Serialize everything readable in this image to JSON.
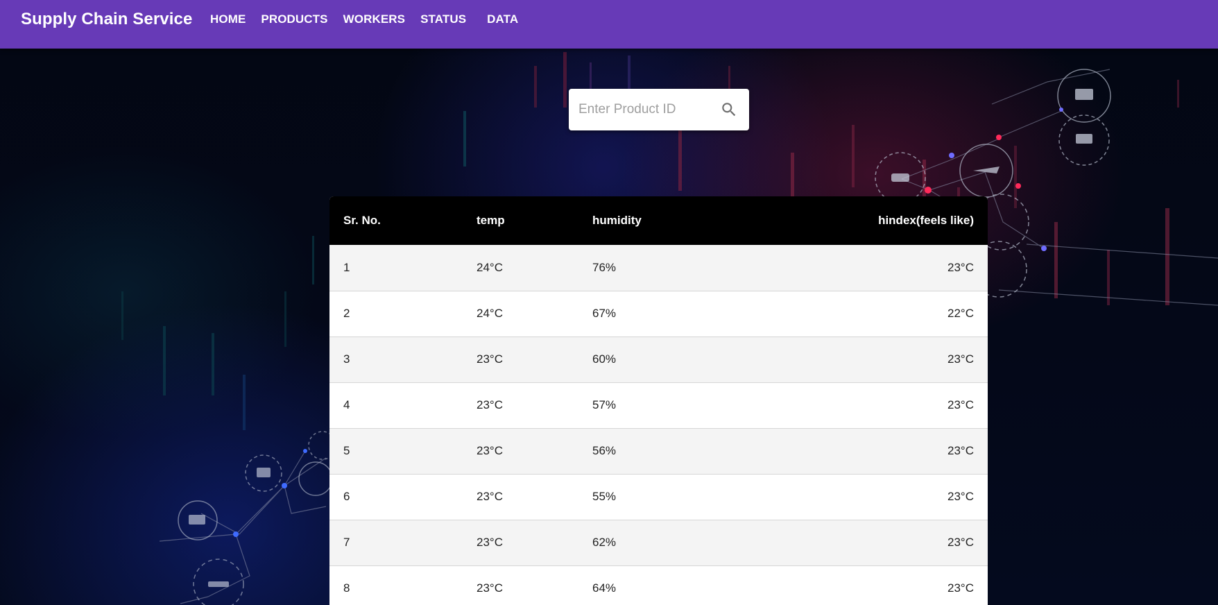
{
  "app": {
    "title": "Supply Chain Service"
  },
  "nav": {
    "items": [
      "HOME",
      "PRODUCTS",
      "WORKERS",
      "STATUS",
      "DATA"
    ]
  },
  "search": {
    "placeholder": "Enter Product ID",
    "value": "",
    "icon": "search-icon"
  },
  "table": {
    "headers": [
      "Sr. No.",
      "temp",
      "humidity",
      "hindex(feels like)"
    ],
    "rows": [
      [
        "1",
        "24°C",
        "76%",
        "23°C"
      ],
      [
        "2",
        "24°C",
        "67%",
        "22°C"
      ],
      [
        "3",
        "23°C",
        "60%",
        "23°C"
      ],
      [
        "4",
        "23°C",
        "57%",
        "23°C"
      ],
      [
        "5",
        "23°C",
        "56%",
        "23°C"
      ],
      [
        "6",
        "23°C",
        "55%",
        "23°C"
      ],
      [
        "7",
        "23°C",
        "62%",
        "23°C"
      ],
      [
        "8",
        "23°C",
        "64%",
        "23°C"
      ]
    ]
  },
  "colors": {
    "appbar": "#673ab7",
    "table_header": "#000000",
    "row_odd": "#f4f4f4",
    "row_even": "#ffffff"
  }
}
